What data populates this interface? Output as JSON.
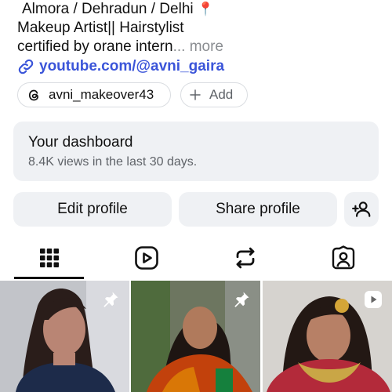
{
  "bio": {
    "location": "Almora / Dehradun / Delhi",
    "location_pin": "📍",
    "line2": "Makeup Artist|| Hairstylist",
    "line3": "certified by orane intern",
    "ellipsis": "...",
    "more": "more",
    "link": "youtube.com/@avni_gaira"
  },
  "chips": {
    "threads": "avni_makeover43",
    "add": "Add"
  },
  "dashboard": {
    "title": "Your dashboard",
    "subtitle": "8.4K views in the last 30 days."
  },
  "actions": {
    "edit": "Edit profile",
    "share": "Share profile"
  },
  "tabs": [
    {
      "name": "grid",
      "icon": "grid-icon",
      "active": true
    },
    {
      "name": "reels",
      "icon": "reels-icon",
      "active": false
    },
    {
      "name": "reposts",
      "icon": "repost-icon",
      "active": false
    },
    {
      "name": "tagged",
      "icon": "tagged-icon",
      "active": false
    }
  ],
  "posts": [
    {
      "badge": "pin-icon"
    },
    {
      "badge": "pin-icon"
    },
    {
      "badge": "reel-icon"
    }
  ],
  "colors": {
    "link": "#3b55d9",
    "panel": "#eff1f4",
    "muted": "#5f6368"
  }
}
